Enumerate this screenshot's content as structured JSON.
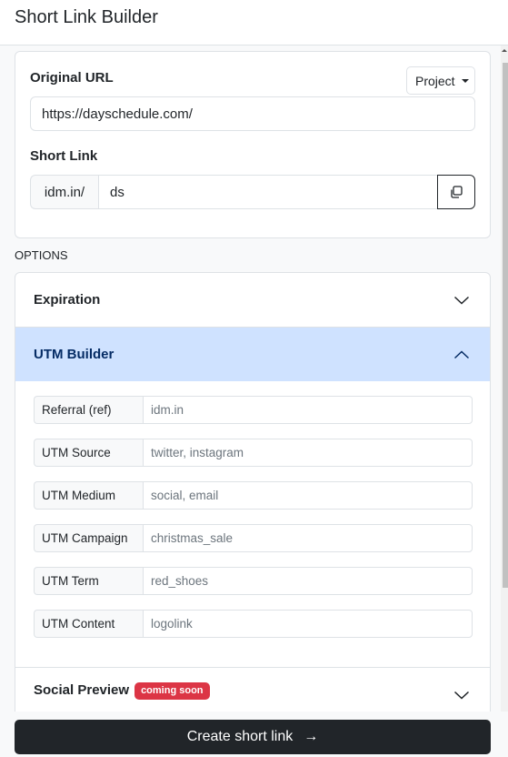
{
  "header": {
    "title": "Short Link Builder"
  },
  "original_url": {
    "label": "Original URL",
    "value": "https://dayschedule.com/",
    "project_button": "Project",
    "project_icon": "caret-down-icon"
  },
  "short_link": {
    "label": "Short Link",
    "prefix": "idm.in/",
    "value": "ds",
    "copy_icon": "copy-icon"
  },
  "options": {
    "label": "OPTIONS",
    "sections": [
      {
        "title": "Expiration",
        "expanded": false,
        "icon": "chevron-down-icon"
      },
      {
        "title": "UTM Builder",
        "expanded": true,
        "icon": "chevron-up-icon"
      },
      {
        "title": "Social Preview",
        "expanded": false,
        "icon": "chevron-down-icon",
        "badge": "coming soon"
      }
    ],
    "utm_fields": [
      {
        "label": "Referral (ref)",
        "placeholder": "idm.in"
      },
      {
        "label": "UTM Source",
        "placeholder": "twitter, instagram"
      },
      {
        "label": "UTM Medium",
        "placeholder": "social, email"
      },
      {
        "label": "UTM Campaign",
        "placeholder": "christmas_sale"
      },
      {
        "label": "UTM Term",
        "placeholder": "red_shoes"
      },
      {
        "label": "UTM Content",
        "placeholder": "logolink"
      }
    ]
  },
  "footer": {
    "create_button": "Create short link",
    "arrow": "→"
  },
  "colors": {
    "active_section_bg": "#cfe2ff",
    "active_section_text": "#052c65",
    "badge": "#dc3545",
    "primary_button": "#212529"
  }
}
